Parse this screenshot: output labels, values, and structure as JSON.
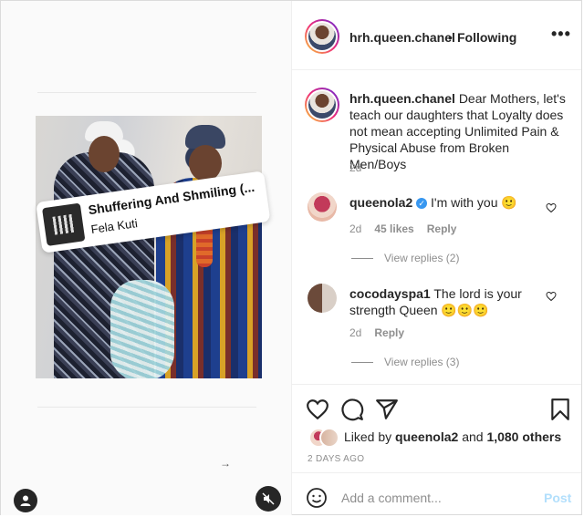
{
  "post": {
    "author": "hrh.queen.chanel",
    "separator": "•",
    "follow_state": "Following",
    "more_icon": "•••",
    "caption": "Dear Mothers, let's teach our daughters that Loyalty does not mean accepting Unlimited Pain & Physical Abuse from Broken Men/Boys",
    "caption_age": "2d"
  },
  "media": {
    "music": {
      "title": "Shuffering And Shmiling (...",
      "artist": "Fela Kuti"
    },
    "arrow": "→"
  },
  "comments": [
    {
      "user": "queenola2",
      "verified": true,
      "text": "I'm with you 🙂",
      "age": "2d",
      "likes": "45 likes",
      "reply_label": "Reply",
      "view_replies": "View replies (2)"
    },
    {
      "user": "cocodayspa1",
      "verified": false,
      "text": "The lord is your strength Queen 🙂🙂🙂",
      "age": "2d",
      "reply_label": "Reply",
      "view_replies": "View replies (3)"
    }
  ],
  "likes": {
    "prefix": "Liked by",
    "user": "queenola2",
    "joiner": "and",
    "others": "1,080 others"
  },
  "post_date": "2 DAYS AGO",
  "comment_box": {
    "placeholder": "Add a comment...",
    "post_label": "Post"
  },
  "colors": {
    "link_blue": "#3897f0",
    "post_disabled": "#b2dffc",
    "meta_gray": "#8e8e8e"
  },
  "icons": [
    "heart-icon",
    "comment-icon",
    "share-icon",
    "bookmark-icon",
    "emoji-icon",
    "user-tag-icon",
    "mute-icon",
    "more-icon"
  ]
}
